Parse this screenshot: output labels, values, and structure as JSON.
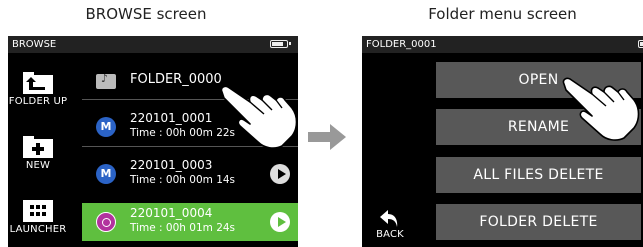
{
  "captions": {
    "left": "BROWSE screen",
    "right": "Folder menu screen"
  },
  "browse": {
    "title": "BROWSE",
    "sidebar": [
      {
        "label": "FOLDER UP",
        "icon": "folder-up-icon"
      },
      {
        "label": "NEW",
        "icon": "new-folder-icon"
      },
      {
        "label": "LAUNCHER",
        "icon": "launcher-grid-icon"
      }
    ],
    "rows": [
      {
        "name": "FOLDER_0000",
        "time": ""
      },
      {
        "name": "220101_0001",
        "time": "Time : 00h 00m 22s",
        "mono_label": "M"
      },
      {
        "name": "220101_0003",
        "time": "Time : 00h 00m 14s",
        "mono_label": "M"
      },
      {
        "name": "220101_0004",
        "time": "Time : 00h 01m 24s"
      }
    ],
    "selected_row_color": "#5fbf3f"
  },
  "folder_menu": {
    "title": "FOLDER_0001",
    "back_label": "BACK",
    "buttons": [
      "OPEN",
      "RENAME",
      "ALL FILES DELETE",
      "FOLDER DELETE"
    ]
  }
}
